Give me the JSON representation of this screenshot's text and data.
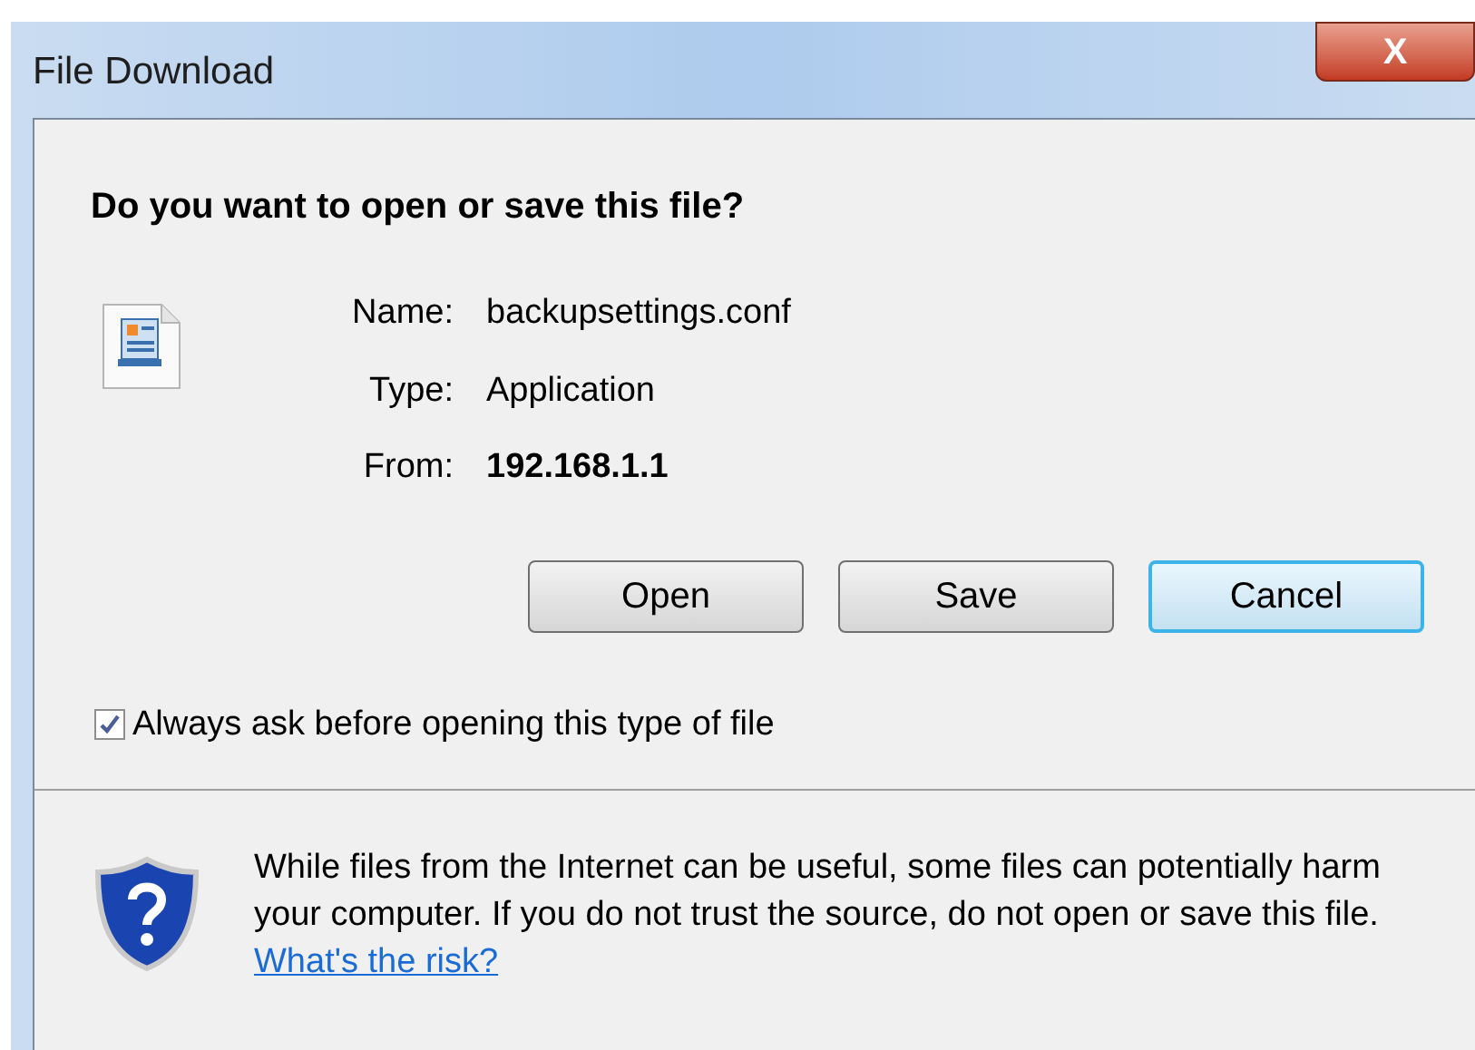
{
  "window": {
    "title": "File Download",
    "close_label": "X"
  },
  "heading": "Do you want to open or save this file?",
  "details": [
    {
      "label": "Name:",
      "value": "backupsettings.conf",
      "bold": false
    },
    {
      "label": "Type:",
      "value": "Application",
      "bold": false
    },
    {
      "label": "From:",
      "value": "192.168.1.1",
      "bold": true
    }
  ],
  "buttons": [
    {
      "label": "Open",
      "default": false
    },
    {
      "label": "Save",
      "default": false
    },
    {
      "label": "Cancel",
      "default": true
    }
  ],
  "checkbox": {
    "label": "Always ask before opening this type of file",
    "checked": true
  },
  "warning": {
    "text": "While files from the Internet can be useful, some files can potentially harm your computer. If you do not trust the source, do not open or save this file.",
    "link": "What's the risk?"
  }
}
